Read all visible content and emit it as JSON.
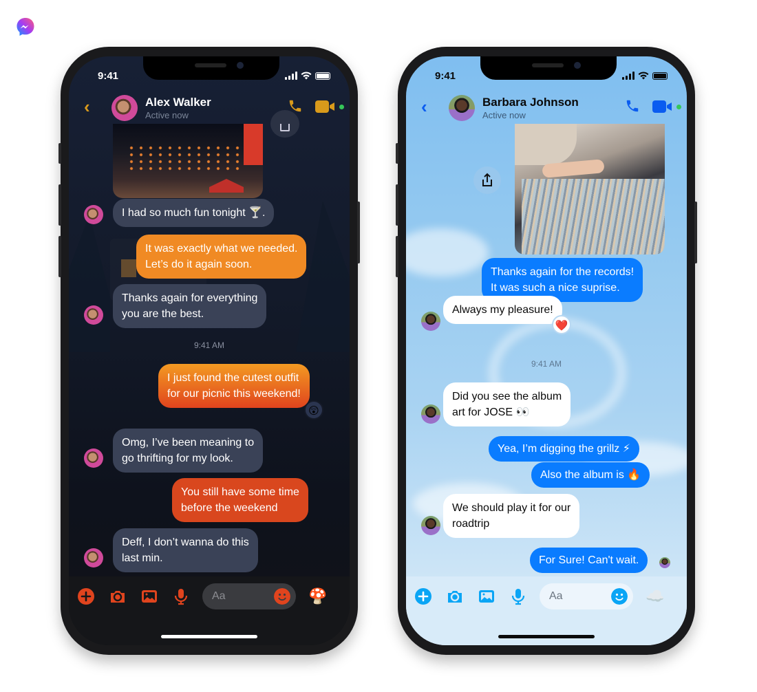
{
  "brand": {
    "logo": "messenger-logo"
  },
  "phones": [
    {
      "theme": "dark",
      "status": {
        "time": "9:41"
      },
      "header": {
        "name": "Alex Walker",
        "status": "Active now",
        "accent": "#d99a1b"
      },
      "shared_image": "night-market-photo",
      "messages": [
        {
          "dir": "in",
          "text": "I had so much fun tonight 🍸."
        },
        {
          "dir": "out",
          "lines": [
            "It was exactly what we needed.",
            "Let’s do it again soon."
          ],
          "color": "#f08a24"
        },
        {
          "dir": "in",
          "lines": [
            "Thanks again for everything",
            "you are the best."
          ]
        },
        {
          "dir": "timestamp",
          "text": "9:41 AM"
        },
        {
          "dir": "out",
          "lines": [
            "I just found the cutest outfit",
            "for our picnic this weekend!"
          ],
          "reaction": "😲"
        },
        {
          "dir": "in",
          "lines": [
            "Omg, I’ve been meaning to",
            "go thrifting for my look."
          ]
        },
        {
          "dir": "out",
          "lines": [
            "You still have some time",
            "before the weekend"
          ]
        },
        {
          "dir": "in",
          "lines": [
            "Deff, I don’t wanna do this",
            "last min."
          ]
        }
      ],
      "composer": {
        "placeholder": "Aa",
        "theme_emoji": "🍄",
        "icon_color": "#e0441e"
      }
    },
    {
      "theme": "light",
      "status": {
        "time": "9:41"
      },
      "header": {
        "name": "Barbara Johnson",
        "status": "Active now",
        "accent": "#0a5cf0"
      },
      "shared_image": "vinyl-records-photo",
      "messages": [
        {
          "dir": "out",
          "lines": [
            "Thanks again for the records!",
            "It was such a nice suprise."
          ]
        },
        {
          "dir": "in",
          "text": "Always my pleasure!",
          "reaction": "❤️"
        },
        {
          "dir": "timestamp",
          "text": "9:41 AM"
        },
        {
          "dir": "in",
          "lines": [
            "Did you see the album",
            "art for JOSE 👀"
          ]
        },
        {
          "dir": "out",
          "text": "Yea, I’m digging the grillz ⚡"
        },
        {
          "dir": "out",
          "text": "Also the album is 🔥"
        },
        {
          "dir": "in",
          "lines": [
            "We should play it for our",
            "roadtrip"
          ]
        },
        {
          "dir": "out",
          "text": "For Sure! Can't wait.",
          "read_receipt": "avatar"
        }
      ],
      "composer": {
        "placeholder": "Aa",
        "theme_emoji": "☁️",
        "icon_color": "#0aa5f5"
      }
    }
  ]
}
